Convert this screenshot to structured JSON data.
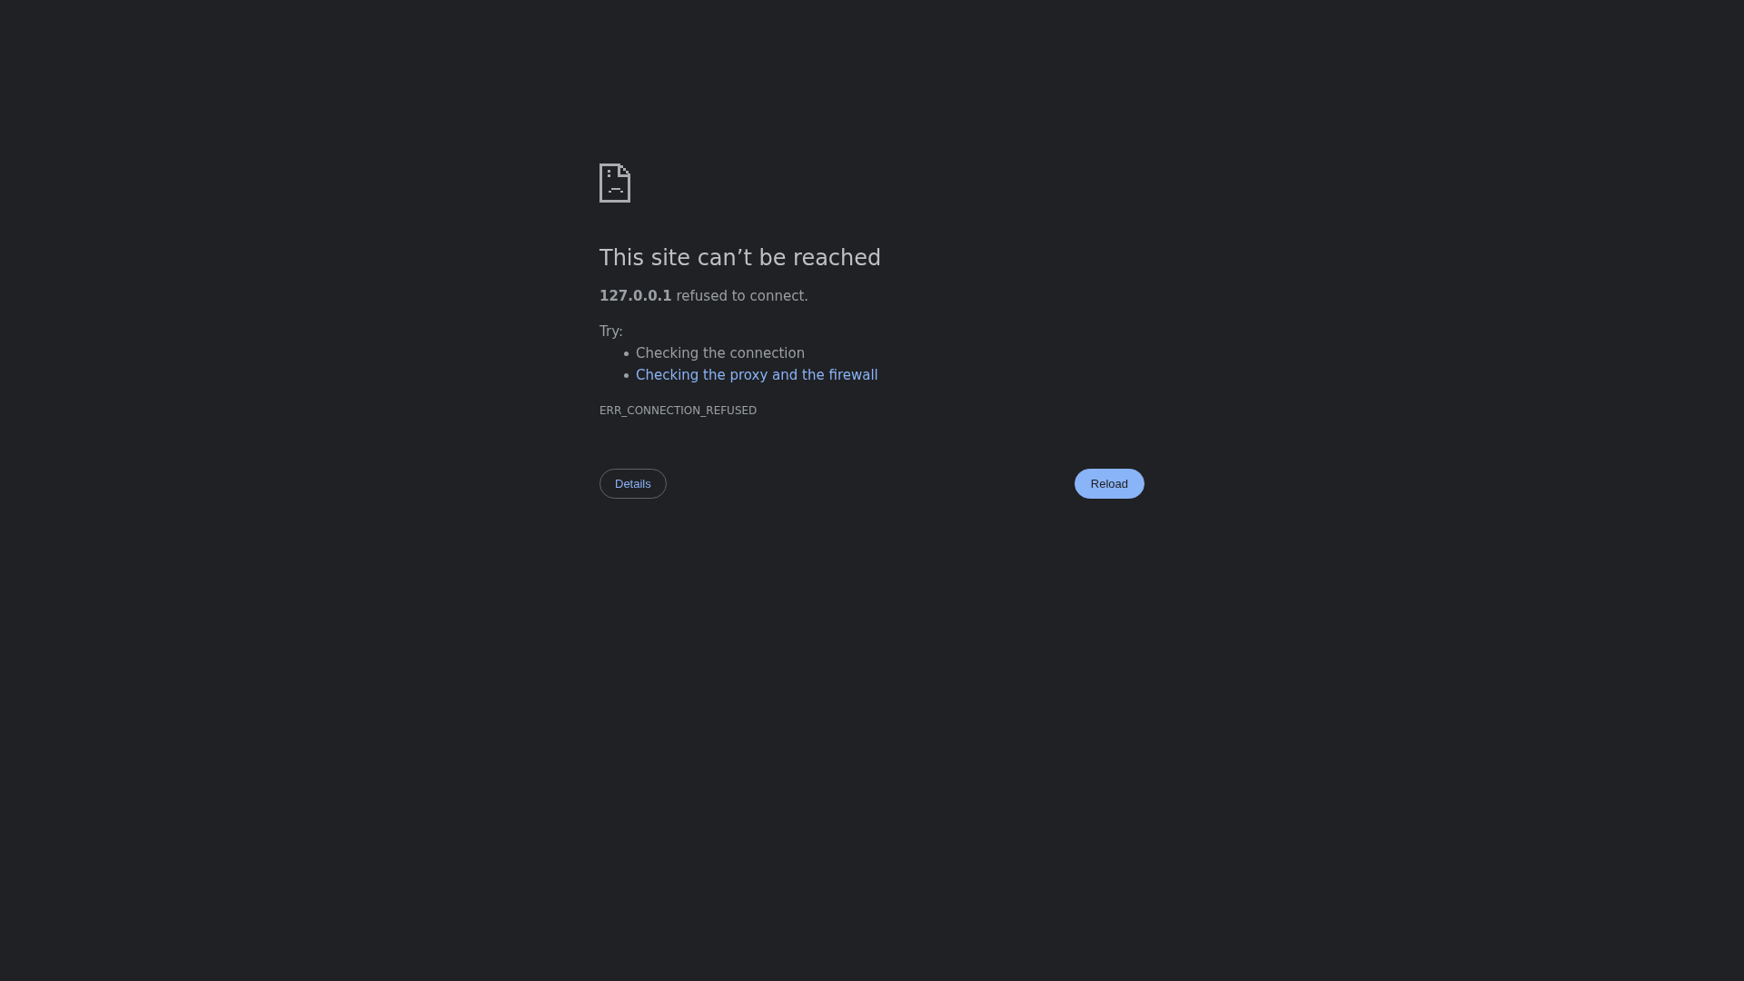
{
  "heading": "This site can’t be reached",
  "message": "**127.0.0.1** refused to connect.",
  "suggestions": {
    "label": "Try:",
    "items": [
      {
        "kind": "text",
        "text": "Checking the connection"
      },
      {
        "kind": "link",
        "text": "Checking the proxy and the firewall"
      }
    ]
  },
  "error_code": "ERR_CONNECTION_REFUSED",
  "buttons": [
    {
      "kind": "secondary",
      "label": "Details"
    },
    {
      "kind": "primary",
      "label": "Reload"
    }
  ]
}
